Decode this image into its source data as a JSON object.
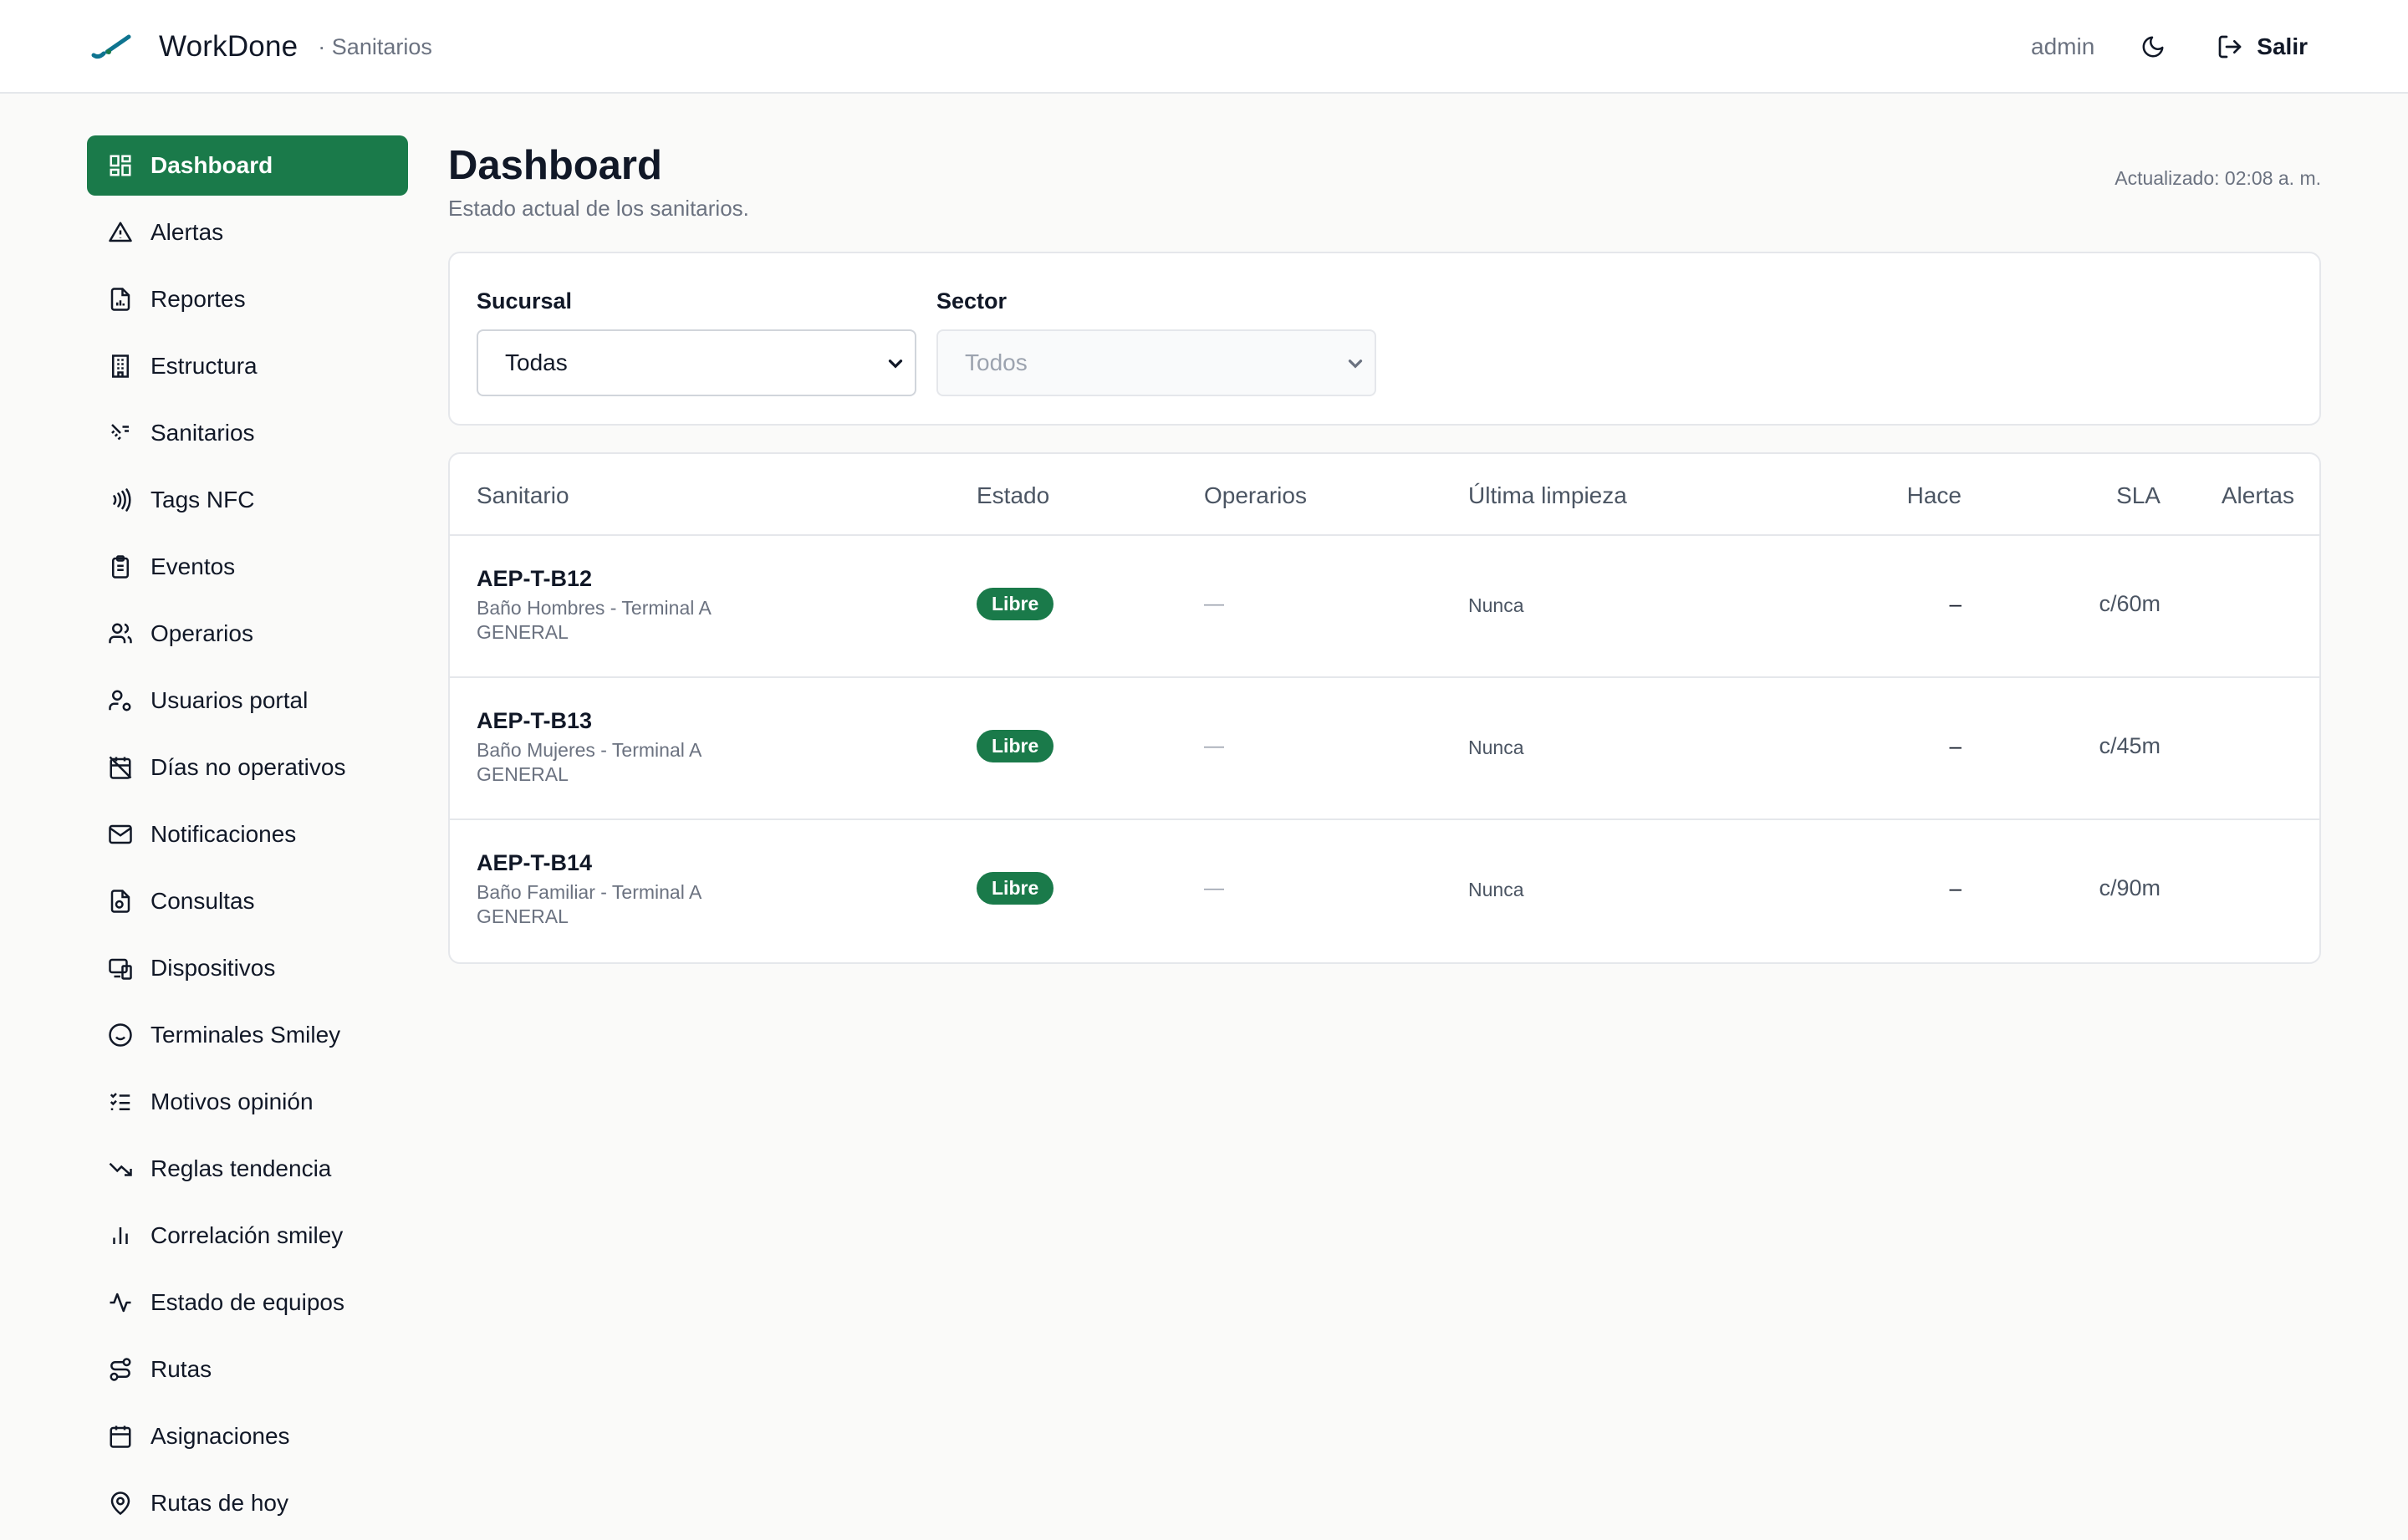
{
  "header": {
    "brand": "WorkDone",
    "section": "· Sanitarios",
    "user": "admin",
    "logout_label": "Salir"
  },
  "sidebar": {
    "items": [
      {
        "label": "Dashboard",
        "icon": "dashboard-icon",
        "active": true
      },
      {
        "label": "Alertas",
        "icon": "alert-triangle-icon"
      },
      {
        "label": "Reportes",
        "icon": "report-file-icon"
      },
      {
        "label": "Estructura",
        "icon": "building-icon"
      },
      {
        "label": "Sanitarios",
        "icon": "toilet-icon"
      },
      {
        "label": "Tags NFC",
        "icon": "nfc-icon"
      },
      {
        "label": "Eventos",
        "icon": "clipboard-icon"
      },
      {
        "label": "Operarios",
        "icon": "users-icon"
      },
      {
        "label": "Usuarios portal",
        "icon": "user-gear-icon"
      },
      {
        "label": "Días no operativos",
        "icon": "calendar-off-icon"
      },
      {
        "label": "Notificaciones",
        "icon": "mail-icon"
      },
      {
        "label": "Consultas",
        "icon": "file-search-icon"
      },
      {
        "label": "Dispositivos",
        "icon": "devices-icon"
      },
      {
        "label": "Terminales Smiley",
        "icon": "smiley-icon"
      },
      {
        "label": "Motivos opinión",
        "icon": "list-checks-icon"
      },
      {
        "label": "Reglas tendencia",
        "icon": "trending-down-icon"
      },
      {
        "label": "Correlación smiley",
        "icon": "bar-chart-icon"
      },
      {
        "label": "Estado de equipos",
        "icon": "activity-icon"
      },
      {
        "label": "Rutas",
        "icon": "route-icon"
      },
      {
        "label": "Asignaciones",
        "icon": "calendar-icon"
      },
      {
        "label": "Rutas de hoy",
        "icon": "map-pin-icon"
      }
    ]
  },
  "main": {
    "title": "Dashboard",
    "subtitle": "Estado actual de los sanitarios.",
    "updated": "Actualizado: 02:08 a. m.",
    "filters": {
      "sucursal_label": "Sucursal",
      "sucursal_value": "Todas",
      "sector_label": "Sector",
      "sector_value": "Todos"
    },
    "table": {
      "columns": [
        "Sanitario",
        "Estado",
        "Operarios",
        "Última limpieza",
        "Hace",
        "SLA",
        "Alertas"
      ],
      "rows": [
        {
          "code": "AEP-T-B12",
          "place": "Baño Hombres - Terminal A",
          "sector": "GENERAL",
          "estado": "Libre",
          "operarios": "—",
          "ultima": "Nunca",
          "hace": "–",
          "sla": "c/60m",
          "alertas": ""
        },
        {
          "code": "AEP-T-B13",
          "place": "Baño Mujeres - Terminal A",
          "sector": "GENERAL",
          "estado": "Libre",
          "operarios": "—",
          "ultima": "Nunca",
          "hace": "–",
          "sla": "c/45m",
          "alertas": ""
        },
        {
          "code": "AEP-T-B14",
          "place": "Baño Familiar - Terminal A",
          "sector": "GENERAL",
          "estado": "Libre",
          "operarios": "—",
          "ultima": "Nunca",
          "hace": "–",
          "sla": "c/90m",
          "alertas": ""
        }
      ]
    }
  },
  "colors": {
    "accent": "#1a7a4a",
    "logo": "#0e7490"
  }
}
